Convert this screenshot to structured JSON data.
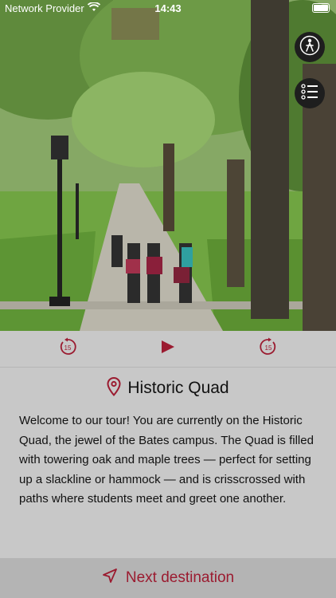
{
  "status_bar": {
    "carrier": "Network Provider",
    "time": "14:43"
  },
  "icons": {
    "wifi": "wifi-icon",
    "battery": "battery-icon",
    "walking": "walking-person-icon",
    "list": "list-icon",
    "rewind": "rewind-15-icon",
    "play": "play-icon",
    "forward": "forward-15-icon",
    "pin": "location-pin-icon",
    "navigate": "navigation-arrow-icon"
  },
  "player": {
    "rewind_label": "15",
    "forward_label": "15"
  },
  "location": {
    "title": "Historic Quad",
    "description": "Welcome to our tour! You are currently on the Historic Quad, the jewel of the Bates campus. The Quad is filled with towering oak and maple trees — perfect for setting up a slackline or hammock — and is crisscrossed with paths where students meet and greet one another."
  },
  "footer": {
    "next_label": "Next destination"
  },
  "colors": {
    "accent": "#9b1b30",
    "panel": "#c8c8c8",
    "footer": "#b4b4b4"
  }
}
